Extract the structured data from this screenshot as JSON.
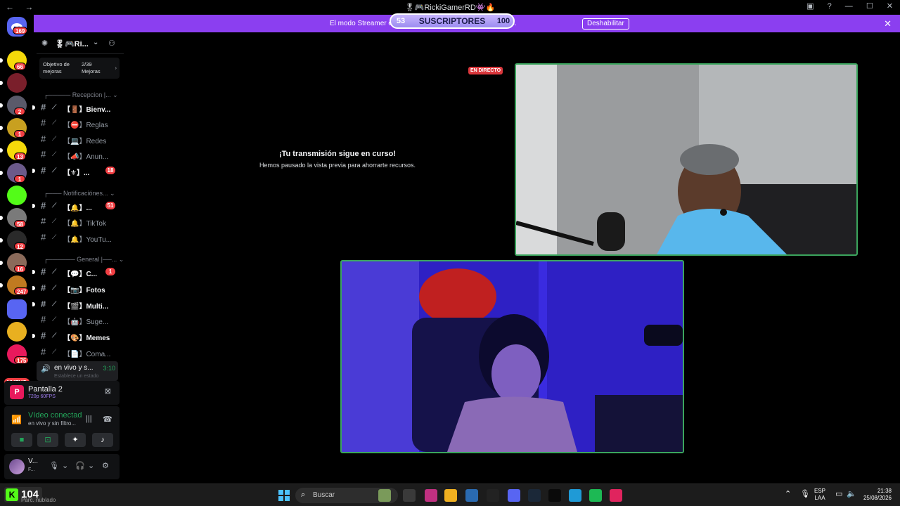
{
  "titlebar": {
    "back": "←",
    "forward": "→",
    "title": "🎖🎮RickiGamerRD👾🔥"
  },
  "banner": {
    "text": "El modo Streamer est… …ares de usuario se han truncado.",
    "button": "Deshabilitar",
    "close": "✕"
  },
  "subs_overlay": {
    "left": "53",
    "label": "SUSCRIPTORES",
    "right": "100"
  },
  "rail": {
    "home_badge": "169",
    "servers": [
      {
        "badge": "66",
        "color": "#f5d90a"
      },
      {
        "badge": "",
        "color": "#7a1f2b"
      },
      {
        "badge": "2",
        "color": "#5a5a6a"
      },
      {
        "badge": "1",
        "color": "#c8a020"
      },
      {
        "badge": "13",
        "color": "#f5d90a"
      },
      {
        "badge": "1",
        "color": "#6b5a8a"
      },
      {
        "badge": "",
        "color": "#53fc18"
      },
      {
        "badge": "58",
        "color": "#7a7a7a"
      },
      {
        "badge": "12",
        "color": "#2a2a2a"
      },
      {
        "badge": "16",
        "color": "#8a6a5a"
      },
      {
        "badge": "247",
        "color": "#c07a20"
      },
      {
        "badge": "",
        "color": "#5865f2"
      },
      {
        "badge": "",
        "color": "#e8b020"
      },
      {
        "badge": "175",
        "color": "#e8195c"
      }
    ],
    "nuevo": "NUEVO"
  },
  "server": {
    "name": "🎖🎮Ri...",
    "boost_goal": "Objetivo de mejoras",
    "boost_count": "2/39 Mejoras"
  },
  "categories": [
    {
      "label": "┌───── Recepcion |..."
    },
    {
      "label": "┌─── Notificaciónes..."
    },
    {
      "label": "┌────── General |──..."
    }
  ],
  "channels": [
    {
      "label": "【🚪】Bienv...",
      "unread": true,
      "badge": ""
    },
    {
      "label": "【⛔】Reglas",
      "unread": false,
      "badge": ""
    },
    {
      "label": "【💻】Redes",
      "unread": false,
      "badge": ""
    },
    {
      "label": "【📣】Anun...",
      "unread": false,
      "badge": ""
    },
    {
      "label": "【⚜】...",
      "unread": true,
      "badge": "18"
    },
    {
      "label": "【🔔】...",
      "unread": true,
      "badge": "51"
    },
    {
      "label": "【🔔】TikTok",
      "unread": false,
      "badge": ""
    },
    {
      "label": "【🔔】YouTu...",
      "unread": false,
      "badge": ""
    },
    {
      "label": "【💬】C...",
      "unread": true,
      "badge": "1"
    },
    {
      "label": "【📷】Fotos",
      "unread": true,
      "badge": ""
    },
    {
      "label": "【🎬】Multi...",
      "unread": true,
      "badge": ""
    },
    {
      "label": "【🤖】Suge...",
      "unread": false,
      "badge": ""
    },
    {
      "label": "【🎨】Memes",
      "unread": true,
      "badge": ""
    },
    {
      "label": "【📄】Coma...",
      "unread": false,
      "badge": ""
    }
  ],
  "voice_channel": {
    "name": "en vivo y s...",
    "time": "3:10",
    "status": "Establece un estado"
  },
  "screen_share": {
    "avatar": "P",
    "name": "Pantalla 2",
    "quality": "720p 60FPS"
  },
  "connection": {
    "title": "Vídeo conectad",
    "subtitle": "en vivo y sin filtro..."
  },
  "user": {
    "name": "V...",
    "status": "F..."
  },
  "stage": {
    "title": "¡Tu transmisión sigue en curso!",
    "subtitle": "Hemos pausado la vista previa para ahorrarte recursos.",
    "live": "EN DIRECTO"
  },
  "taskbar": {
    "kick_value": "104",
    "kick_sub": "Parc. nublado",
    "search": "Buscar",
    "lang1": "ESP",
    "lang2": "LAA",
    "time": "21:38",
    "date": "25/08/2026"
  }
}
